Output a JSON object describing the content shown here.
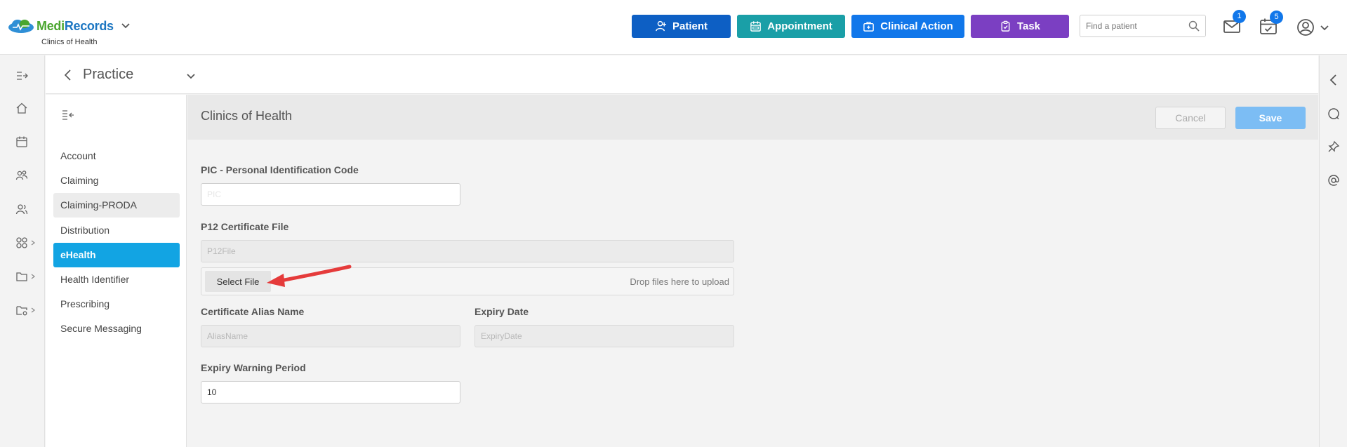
{
  "app": {
    "logo_medi": "Medi",
    "logo_records": "Records",
    "clinic": "Clinics of Health"
  },
  "topbar": {
    "buttons": [
      {
        "label": "Patient",
        "icon": "user-plus-icon",
        "color": "#0d5fc4"
      },
      {
        "label": "Appointment",
        "icon": "calendar-icon",
        "color": "#1a9fa7"
      },
      {
        "label": "Clinical Action",
        "icon": "medical-kit-icon",
        "color": "#1177ea"
      },
      {
        "label": "Task",
        "icon": "clipboard-check-icon",
        "color": "#7b3fc2"
      }
    ],
    "search_placeholder": "Find a patient",
    "mail_badge": "1",
    "tasks_badge": "5"
  },
  "breadcrumb": {
    "title": "Practice"
  },
  "settings_nav": {
    "items": [
      {
        "label": "Account"
      },
      {
        "label": "Claiming"
      },
      {
        "label": "Claiming-PRODA"
      },
      {
        "label": "Distribution"
      },
      {
        "label": "eHealth"
      },
      {
        "label": "Health Identifier"
      },
      {
        "label": "Prescribing"
      },
      {
        "label": "Secure Messaging"
      }
    ],
    "active": "eHealth"
  },
  "main": {
    "title": "Clinics of Health",
    "cancel_label": "Cancel",
    "save_label": "Save",
    "pic": {
      "label": "PIC - Personal Identification Code",
      "value": "PIC"
    },
    "p12": {
      "label": "P12 Certificate File",
      "placeholder": "P12File"
    },
    "upload": {
      "button": "Select File",
      "drop_text": "Drop files here to upload"
    },
    "alias": {
      "label": "Certificate Alias Name",
      "placeholder": "AliasName"
    },
    "expiry": {
      "label": "Expiry Date",
      "placeholder": "ExpiryDate"
    },
    "warning": {
      "label": "Expiry Warning Period",
      "value": "10"
    }
  },
  "colors": {
    "accent": "#12a4e3",
    "annotation_arrow": "#e53b3b"
  }
}
